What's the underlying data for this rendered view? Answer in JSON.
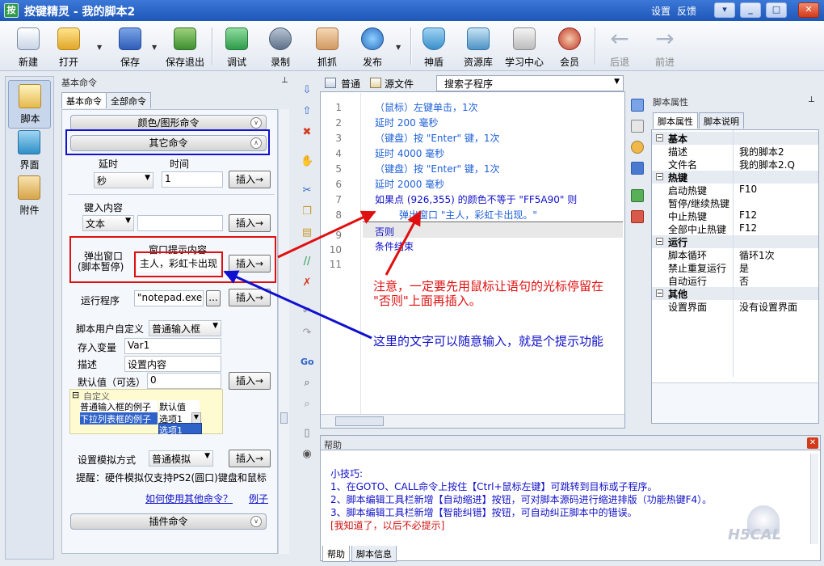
{
  "window": {
    "title": "按键精灵 - 我的脚本2",
    "settings": "设置",
    "feedback": "反馈"
  },
  "toolbar": {
    "new": "新建",
    "open": "打开",
    "save": "保存",
    "save_exit": "保存退出",
    "debug": "调试",
    "record": "录制",
    "capture": "抓抓",
    "publish": "发布",
    "shield": "神盾",
    "resources": "资源库",
    "learning": "学习中心",
    "member": "会员",
    "back": "后退",
    "forward": "前进"
  },
  "nav": {
    "script": "脚本",
    "ui": "界面",
    "attach": "附件"
  },
  "cmd_panel": {
    "title": "基本命令",
    "tab_basic": "基本命令",
    "tab_all": "全部命令",
    "group_color": "颜色/图形命令",
    "group_other": "其它命令",
    "group_plugin": "插件命令",
    "delay_label": "延时",
    "time_label": "时间",
    "delay_unit": "秒",
    "delay_value": "1",
    "insert": "插入→",
    "type_label": "键入内容",
    "type_mode": "文本",
    "popup_label1": "弹出窗口",
    "popup_label2": "(脚本暂停)",
    "popup_hint_label": "窗口提示内容",
    "popup_text": "主人，彩虹卡出现",
    "run_label": "运行程序",
    "run_value": "\"notepad.exe\"",
    "browse": "...",
    "custom_label": "脚本用户自定义",
    "custom_type": "普通输入框",
    "var_label": "存入变量",
    "var_value": "Var1",
    "desc_label": "描述",
    "desc_value": "设置内容",
    "default_label": "默认值（可选）",
    "default_value": "0",
    "custom_section": "自定义",
    "ex1_name": "普通输入框的例子",
    "ex1_value": "默认值",
    "ex2_name": "下拉列表框的例子",
    "ex2_value": "选项1",
    "ex2_dropdown": "选项1",
    "sim_label": "设置模拟方式",
    "sim_value": "普通模拟",
    "tip": "提醒：硬件模拟仅支持PS2(圆口)键盘和鼠标",
    "howto": "如何使用其他命令？",
    "example": "例子"
  },
  "editor": {
    "tab_normal": "普通",
    "tab_source": "源文件",
    "search": "搜索子程序",
    "lines": [
      {
        "no": "1",
        "text": "（鼠标）左键单击，1次"
      },
      {
        "no": "2",
        "text": "延时 200 毫秒"
      },
      {
        "no": "3",
        "text": "（键盘）按 \"Enter\" 键，1次"
      },
      {
        "no": "4",
        "text": "延时 4000 毫秒"
      },
      {
        "no": "5",
        "text": "（键盘）按 \"Enter\" 键，1次"
      },
      {
        "no": "6",
        "text": "延时 2000 毫秒"
      },
      {
        "no": "7",
        "text": "如果点 (926,355) 的颜色不等于 \"FF5A90\" 则"
      },
      {
        "no": "8",
        "text": "弹出窗口 \"主人，彩虹卡出现。\""
      },
      {
        "no": "9",
        "text": "否则"
      },
      {
        "no": "10",
        "text": "条件结束"
      },
      {
        "no": "11",
        "text": ""
      }
    ],
    "annotation1a": "注意，一定要先用鼠标让语句的光标停留在",
    "annotation1b": "\"否则\"上面再插入。",
    "annotation2": "这里的文字可以随意输入，就是个提示功能"
  },
  "props": {
    "title": "脚本属性",
    "tab_props": "脚本属性",
    "tab_desc": "脚本说明",
    "sections": [
      {
        "name": "基本",
        "rows": [
          {
            "k": "描述",
            "v": "我的脚本2"
          },
          {
            "k": "文件名",
            "v": "我的脚本2.Q"
          }
        ]
      },
      {
        "name": "热键",
        "rows": [
          {
            "k": "启动热键",
            "v": "F10"
          },
          {
            "k": "暂停/继续热键",
            "v": ""
          },
          {
            "k": "中止热键",
            "v": "F12"
          },
          {
            "k": "全部中止热键",
            "v": "F12"
          }
        ]
      },
      {
        "name": "运行",
        "rows": [
          {
            "k": "脚本循环",
            "v": "循环1次"
          },
          {
            "k": "禁止重复运行",
            "v": "是"
          },
          {
            "k": "自动运行",
            "v": "否"
          }
        ]
      },
      {
        "name": "其他",
        "rows": [
          {
            "k": "设置界面",
            "v": "没有设置界面"
          }
        ]
      }
    ]
  },
  "help": {
    "title": "帮助",
    "tips_title": "小技巧:",
    "tip1": "1、在GOTO、CALL命令上按住【Ctrl+鼠标左键】可跳转到目标或子程序。",
    "tip2": "2、脚本编辑工具栏新增【自动缩进】按钮，可对脚本源码进行缩进排版（功能热键F4）。",
    "tip3": "3、脚本编辑工具栏新增【智能纠错】按钮，可自动纠正脚本中的错误。",
    "dismiss": "[我知道了，以后不必提示]",
    "tab_help": "帮助",
    "tab_info": "脚本信息"
  },
  "colors": {
    "title_bar": "#1d57b8",
    "code_blue": "#1e60d8",
    "annotation_red": "#e01010",
    "annotation_blue": "#1010d0"
  }
}
